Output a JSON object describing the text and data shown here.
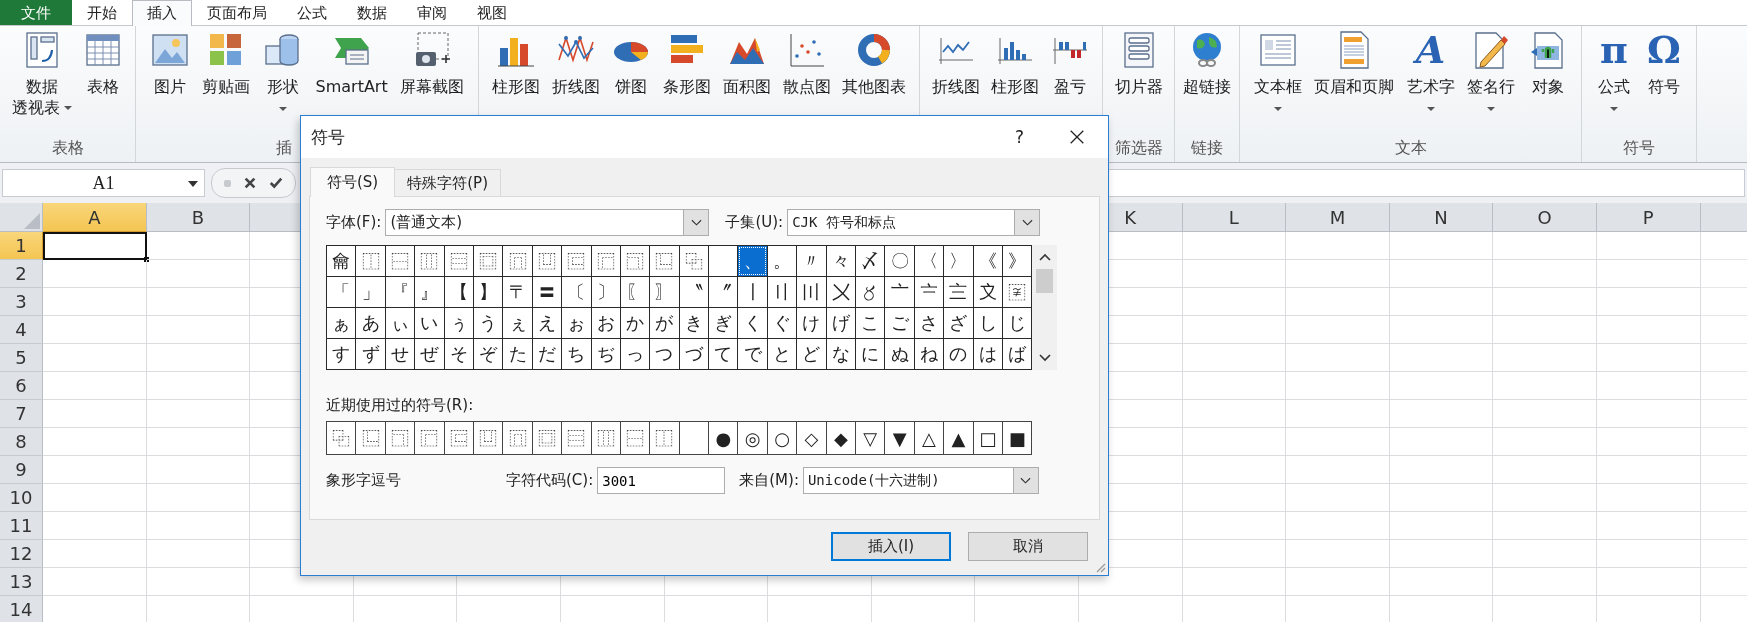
{
  "ribbon_tabs": [
    {
      "label": "文件",
      "kind": "file",
      "selected": false
    },
    {
      "label": "开始",
      "kind": "tab",
      "selected": false
    },
    {
      "label": "插入",
      "kind": "tab",
      "selected": true
    },
    {
      "label": "页面布局",
      "kind": "tab",
      "selected": false
    },
    {
      "label": "公式",
      "kind": "tab",
      "selected": false
    },
    {
      "label": "数据",
      "kind": "tab",
      "selected": false
    },
    {
      "label": "审阅",
      "kind": "tab",
      "selected": false
    },
    {
      "label": "视图",
      "kind": "tab",
      "selected": false
    }
  ],
  "ribbon_groups": [
    {
      "label": "表格",
      "buttons": [
        {
          "lines": [
            "数据",
            "透视表"
          ],
          "dropdown": true
        },
        {
          "lines": [
            "表格"
          ],
          "dropdown": false
        }
      ]
    },
    {
      "label": "插",
      "buttons": [
        {
          "lines": [
            "图片"
          ],
          "dropdown": false
        },
        {
          "lines": [
            "剪贴画"
          ],
          "dropdown": false
        },
        {
          "lines": [
            "形状"
          ],
          "dropdown": true
        },
        {
          "lines": [
            "SmartArt"
          ],
          "dropdown": false
        },
        {
          "lines": [
            "屏幕截图"
          ],
          "dropdown": false
        }
      ]
    },
    {
      "buttons": [
        {
          "lines": [
            "柱形图"
          ],
          "dropdown": false
        },
        {
          "lines": [
            "折线图"
          ],
          "dropdown": false
        },
        {
          "lines": [
            "饼图"
          ],
          "dropdown": false
        },
        {
          "lines": [
            "条形图"
          ],
          "dropdown": false
        },
        {
          "lines": [
            "面积图"
          ],
          "dropdown": false
        },
        {
          "lines": [
            "散点图"
          ],
          "dropdown": false
        },
        {
          "lines": [
            "其他图表"
          ],
          "dropdown": false
        }
      ]
    },
    {
      "buttons": [
        {
          "lines": [
            "折线图"
          ],
          "dropdown": false
        },
        {
          "lines": [
            "柱形图"
          ],
          "dropdown": false
        },
        {
          "lines": [
            "盈亏"
          ],
          "dropdown": false
        }
      ]
    },
    {
      "label": "筛选器",
      "buttons": [
        {
          "lines": [
            "切片器"
          ],
          "dropdown": false
        }
      ]
    },
    {
      "label": "链接",
      "buttons": [
        {
          "lines": [
            "超链接"
          ],
          "dropdown": false
        }
      ]
    },
    {
      "label": "文本",
      "buttons": [
        {
          "lines": [
            "文本框"
          ],
          "dropdown": true
        },
        {
          "lines": [
            "页眉和页脚"
          ],
          "dropdown": false
        },
        {
          "lines": [
            "艺术字"
          ],
          "dropdown": true,
          "glyph": "A"
        },
        {
          "lines": [
            "签名行"
          ],
          "dropdown": true
        },
        {
          "lines": [
            "对象"
          ],
          "dropdown": false
        }
      ]
    },
    {
      "label": "符号",
      "buttons": [
        {
          "lines": [
            "公式"
          ],
          "dropdown": true,
          "glyph": "π"
        },
        {
          "lines": [
            "符号"
          ],
          "dropdown": false,
          "glyph": "Ω"
        }
      ]
    }
  ],
  "name_box": {
    "value": "A1"
  },
  "columns_left": [
    {
      "label": "A",
      "selected": true
    },
    {
      "label": "B",
      "selected": false
    }
  ],
  "columns_right": [
    {
      "label": "K",
      "selected": false
    },
    {
      "label": "L",
      "selected": false
    },
    {
      "label": "M",
      "selected": false
    },
    {
      "label": "N",
      "selected": false
    },
    {
      "label": "O",
      "selected": false
    },
    {
      "label": "P",
      "selected": false
    }
  ],
  "rows": [
    {
      "label": "1",
      "selected": true
    },
    {
      "label": "2",
      "selected": false
    },
    {
      "label": "3",
      "selected": false
    },
    {
      "label": "4",
      "selected": false
    },
    {
      "label": "5",
      "selected": false
    },
    {
      "label": "6",
      "selected": false
    },
    {
      "label": "7",
      "selected": false
    },
    {
      "label": "8",
      "selected": false
    },
    {
      "label": "9",
      "selected": false
    },
    {
      "label": "10",
      "selected": false
    },
    {
      "label": "11",
      "selected": false
    },
    {
      "label": "12",
      "selected": false
    },
    {
      "label": "13",
      "selected": false
    },
    {
      "label": "14",
      "selected": false
    }
  ],
  "dialog": {
    "title": "符号",
    "help": "?",
    "tabs": [
      {
        "label": "符号(S)",
        "selected": true
      },
      {
        "label": "特殊字符(P)",
        "selected": false
      }
    ],
    "font": {
      "label": "字体(F):",
      "value": "(普通文本)"
    },
    "subset": {
      "label": "子集(U):",
      "value": "CJK 符号和标点"
    },
    "grid": [
      [
        {
          "char": "⿕",
          "selected": false
        },
        {
          "char": "⿰",
          "selected": false
        },
        {
          "char": "⿱",
          "selected": false
        },
        {
          "char": "⿲",
          "selected": false
        },
        {
          "char": "⿳",
          "selected": false
        },
        {
          "char": "⿴",
          "selected": false
        },
        {
          "char": "⿵",
          "selected": false
        },
        {
          "char": "⿶",
          "selected": false
        },
        {
          "char": "⿷",
          "selected": false
        },
        {
          "char": "⿸",
          "selected": false
        },
        {
          "char": "⿹",
          "selected": false
        },
        {
          "char": "⿺",
          "selected": false
        },
        {
          "char": "⿻",
          "selected": false
        },
        {
          "selected": false
        },
        {
          "char": "、",
          "selected": true
        },
        {
          "char": "。",
          "selected": false
        },
        {
          "char": "〃",
          "selected": false
        },
        {
          "char": "々",
          "selected": false
        },
        {
          "char": "〆",
          "selected": false
        },
        {
          "char": "〇",
          "selected": false
        },
        {
          "char": "〈",
          "selected": false
        },
        {
          "char": "〉",
          "selected": false
        },
        {
          "char": "《",
          "selected": false
        },
        {
          "char": "》",
          "selected": false
        }
      ],
      [
        {
          "char": "「",
          "selected": false
        },
        {
          "char": "」",
          "selected": false
        },
        {
          "char": "『",
          "selected": false
        },
        {
          "char": "』",
          "selected": false
        },
        {
          "char": "【",
          "selected": false
        },
        {
          "char": "】",
          "selected": false
        },
        {
          "char": "〒",
          "selected": false
        },
        {
          "char": "〓",
          "selected": false
        },
        {
          "char": "〔",
          "selected": false
        },
        {
          "char": "〕",
          "selected": false
        },
        {
          "char": "〖",
          "selected": false
        },
        {
          "char": "〗",
          "selected": false
        },
        {
          "char": "〝",
          "selected": false
        },
        {
          "char": "〞",
          "selected": false
        },
        {
          "char": "〡",
          "selected": false
        },
        {
          "char": "〢",
          "selected": false
        },
        {
          "char": "〣",
          "selected": false
        },
        {
          "char": "〤",
          "selected": false
        },
        {
          "char": "〥",
          "selected": false
        },
        {
          "char": "〦",
          "selected": false
        },
        {
          "char": "〧",
          "selected": false
        },
        {
          "char": "〨",
          "selected": false
        },
        {
          "char": "〩",
          "selected": false
        },
        {
          "char": "〾",
          "selected": false
        }
      ],
      [
        {
          "char": "ぁ",
          "selected": false
        },
        {
          "char": "あ",
          "selected": false
        },
        {
          "char": "ぃ",
          "selected": false
        },
        {
          "char": "い",
          "selected": false
        },
        {
          "char": "ぅ",
          "selected": false
        },
        {
          "char": "う",
          "selected": false
        },
        {
          "char": "ぇ",
          "selected": false
        },
        {
          "char": "え",
          "selected": false
        },
        {
          "char": "ぉ",
          "selected": false
        },
        {
          "char": "お",
          "selected": false
        },
        {
          "char": "か",
          "selected": false
        },
        {
          "char": "が",
          "selected": false
        },
        {
          "char": "き",
          "selected": false
        },
        {
          "char": "ぎ",
          "selected": false
        },
        {
          "char": "く",
          "selected": false
        },
        {
          "char": "ぐ",
          "selected": false
        },
        {
          "char": "け",
          "selected": false
        },
        {
          "char": "げ",
          "selected": false
        },
        {
          "char": "こ",
          "selected": false
        },
        {
          "char": "ご",
          "selected": false
        },
        {
          "char": "さ",
          "selected": false
        },
        {
          "char": "ざ",
          "selected": false
        },
        {
          "char": "し",
          "selected": false
        },
        {
          "char": "じ",
          "selected": false
        }
      ],
      [
        {
          "char": "す",
          "selected": false
        },
        {
          "char": "ず",
          "selected": false
        },
        {
          "char": "せ",
          "selected": false
        },
        {
          "char": "ぜ",
          "selected": false
        },
        {
          "char": "そ",
          "selected": false
        },
        {
          "char": "ぞ",
          "selected": false
        },
        {
          "char": "た",
          "selected": false
        },
        {
          "char": "だ",
          "selected": false
        },
        {
          "char": "ち",
          "selected": false
        },
        {
          "char": "ぢ",
          "selected": false
        },
        {
          "char": "っ",
          "selected": false
        },
        {
          "char": "つ",
          "selected": false
        },
        {
          "char": "づ",
          "selected": false
        },
        {
          "char": "て",
          "selected": false
        },
        {
          "char": "で",
          "selected": false
        },
        {
          "char": "と",
          "selected": false
        },
        {
          "char": "ど",
          "selected": false
        },
        {
          "char": "な",
          "selected": false
        },
        {
          "char": "に",
          "selected": false
        },
        {
          "char": "ぬ",
          "selected": false
        },
        {
          "char": "ね",
          "selected": false
        },
        {
          "char": "の",
          "selected": false
        },
        {
          "char": "は",
          "selected": false
        },
        {
          "char": "ば",
          "selected": false
        }
      ]
    ],
    "recent_label": "近期使用过的符号(R):",
    "recent": [
      {
        "kind": "char",
        "char": "⿻"
      },
      {
        "kind": "char",
        "char": "⿺"
      },
      {
        "kind": "char",
        "char": "⿹"
      },
      {
        "kind": "char",
        "char": "⿸"
      },
      {
        "kind": "char",
        "char": "⿷"
      },
      {
        "kind": "char",
        "char": "⿶"
      },
      {
        "kind": "char",
        "char": "⿵"
      },
      {
        "kind": "char",
        "char": "⿴"
      },
      {
        "kind": "char",
        "char": "⿳"
      },
      {
        "kind": "char",
        "char": "⿲"
      },
      {
        "kind": "char",
        "char": "⿱"
      },
      {
        "kind": "char",
        "char": "⿰"
      },
      {
        "kind": "blank"
      },
      {
        "kind": "char",
        "char": "●"
      },
      {
        "kind": "char",
        "char": "◎"
      },
      {
        "kind": "char",
        "char": "○"
      },
      {
        "kind": "char",
        "char": "◇"
      },
      {
        "kind": "char",
        "char": "◆"
      },
      {
        "kind": "char",
        "char": "▽"
      },
      {
        "kind": "char",
        "char": "▼"
      },
      {
        "kind": "char",
        "char": "△"
      },
      {
        "kind": "char",
        "char": "▲"
      },
      {
        "kind": "char",
        "char": "□"
      },
      {
        "kind": "char",
        "char": "■"
      }
    ],
    "char_name": "象形字逗号",
    "char_code": {
      "label": "字符代码(C):",
      "value": "3001"
    },
    "from": {
      "label": "来自(M):",
      "value": "Unicode(十六进制)"
    },
    "buttons": [
      {
        "label": "插入(I)",
        "kind": "default"
      },
      {
        "label": "取消",
        "kind": "normal"
      }
    ]
  }
}
